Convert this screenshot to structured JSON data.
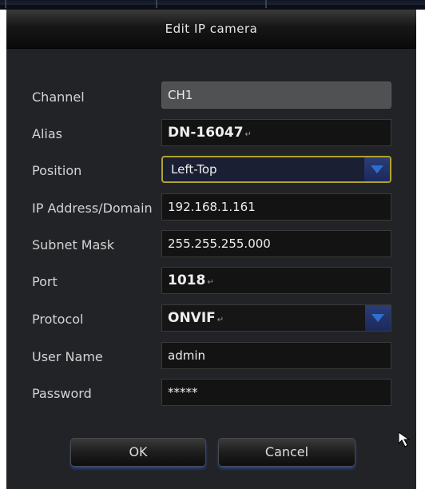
{
  "dialog": {
    "title": "Edit IP camera"
  },
  "fields": [
    {
      "label": "Channel",
      "value": "CH1"
    },
    {
      "label": "Alias",
      "value": "DN-16047",
      "mark": "↵"
    },
    {
      "label": "Position",
      "value": "Left-Top"
    },
    {
      "label": "IP Address/Domain",
      "value": "192.168.1.161"
    },
    {
      "label": "Subnet Mask",
      "value": "255.255.255.000"
    },
    {
      "label": "Port",
      "value": "1018",
      "mark": "↵"
    },
    {
      "label": "Protocol",
      "value": "ONVIF",
      "mark": "↵"
    },
    {
      "label": "User Name",
      "value": "admin"
    },
    {
      "label": "Password",
      "value": "*****"
    }
  ],
  "buttons": {
    "ok": "OK",
    "cancel": "Cancel"
  },
  "icons": {
    "dropdown": "chevron-down-icon",
    "pointer": "mouse-pointer-icon"
  },
  "colors": {
    "focus_border": "#b2a231",
    "dropdown_accent": "#2b3d78",
    "dialog_bg": "#222326"
  }
}
